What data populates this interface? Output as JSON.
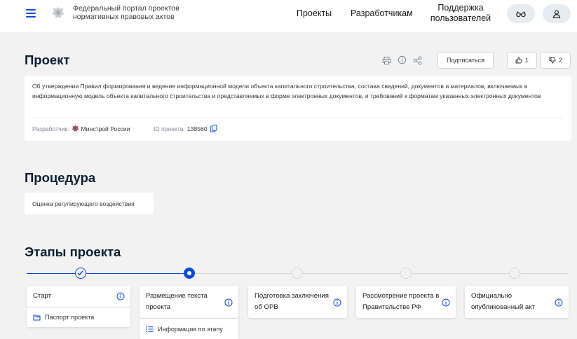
{
  "header": {
    "portal_title": "Федеральный портал проектов нормативных правовых актов",
    "nav": [
      "Проекты",
      "Разработчикам",
      "Поддержка пользователей"
    ]
  },
  "project": {
    "heading": "Проект",
    "subscribe_label": "Подписаться",
    "likes": "1",
    "dislikes": "2",
    "description": "Об утверждении Правил формирования и ведения информационной модели объекта капитального строительства, состава сведений, документов и материалов, включаемых в информационную модель объекта капитального строительства и представляемых в форме электронных документов, и требований к форматам указанных электронных документов",
    "developer_label": "Разработчик:",
    "developer_value": "Минстрой России",
    "id_label": "ID проекта:",
    "id_value": "138560"
  },
  "procedure": {
    "heading": "Процедура",
    "value": "Оценка регулирующего воздействия"
  },
  "stages": {
    "heading": "Этапы проекта",
    "items": [
      {
        "title": "Старт",
        "state": "done"
      },
      {
        "title": "Размещение текста проекта",
        "state": "current"
      },
      {
        "title": "Подготовка заключения об ОРВ",
        "state": "pending"
      },
      {
        "title": "Рассмотрение проекта в Правительстве РФ",
        "state": "pending"
      },
      {
        "title": "Официально опубликованный акт",
        "state": "pending"
      }
    ],
    "start_sub": "Паспорт проекта",
    "current_sub": "Информация по этапу"
  },
  "colors": {
    "accent": "#0d4cd3",
    "page_bg": "#f2f2f2",
    "pending_dot": "#d3d7db"
  }
}
